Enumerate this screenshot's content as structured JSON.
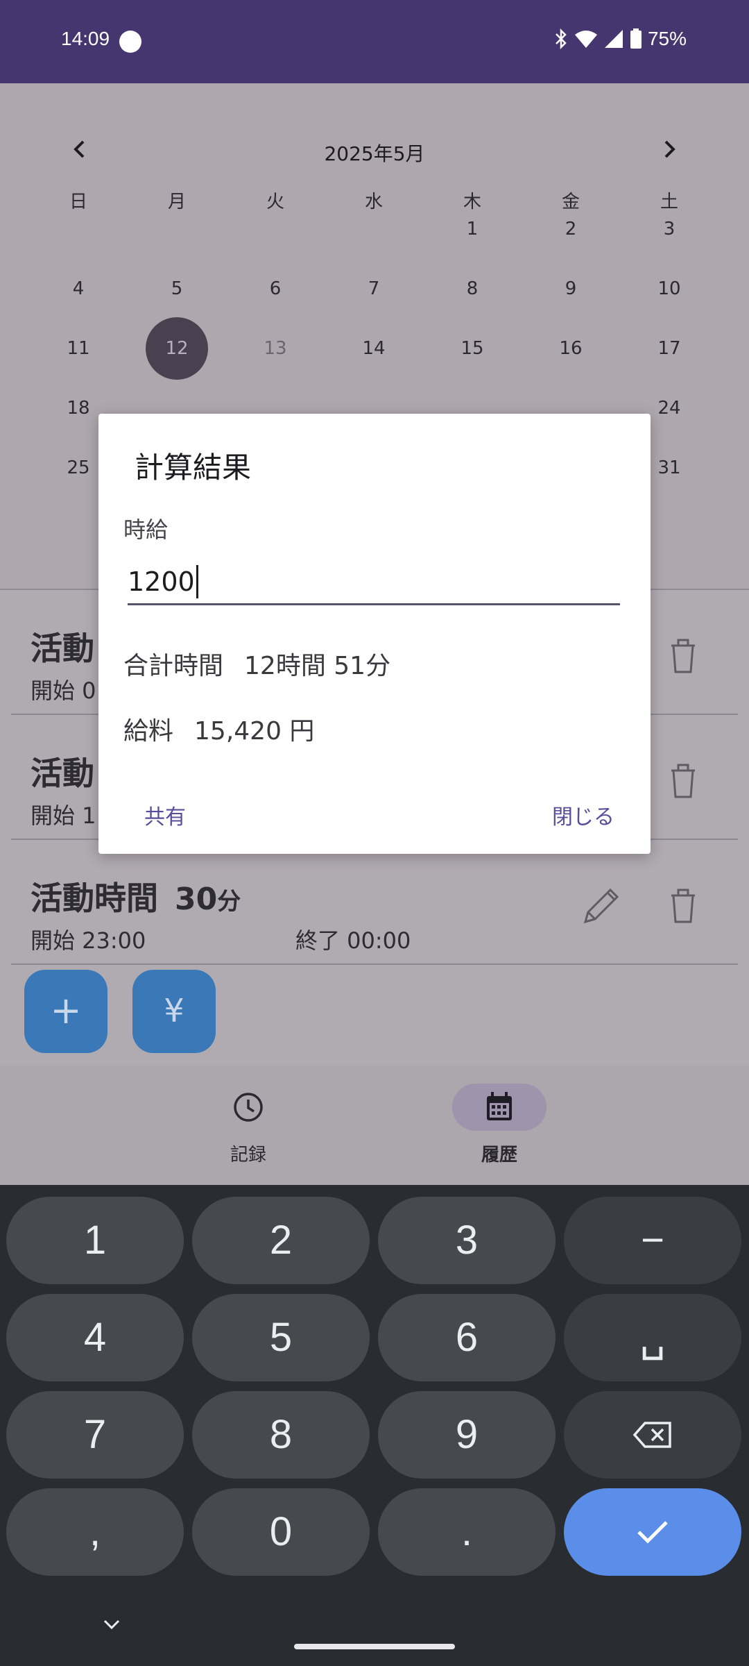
{
  "status_bar": {
    "time": "14:09",
    "battery": "75%"
  },
  "calendar": {
    "title": "2025年5月",
    "weekdays": [
      "日",
      "月",
      "火",
      "水",
      "木",
      "金",
      "土"
    ],
    "rows": [
      [
        "",
        "",
        "",
        "",
        "1",
        "2",
        "3"
      ],
      [
        "4",
        "5",
        "6",
        "7",
        "8",
        "9",
        "10"
      ],
      [
        "11",
        "12",
        "13",
        "14",
        "15",
        "16",
        "17"
      ],
      [
        "18",
        "",
        "",
        "",
        "",
        "",
        "24"
      ],
      [
        "25",
        "",
        "",
        "",
        "",
        "",
        "31"
      ]
    ],
    "selected_day": "12"
  },
  "entries": [
    {
      "title": "活動",
      "start": "開始 0"
    },
    {
      "title": "活動",
      "start": "開始 1"
    },
    {
      "title": "活動時間",
      "duration": "30",
      "duration_unit": "分",
      "start": "開始  23:00",
      "end": "終了  00:00"
    }
  ],
  "fabs": {
    "add": "+",
    "yen": "¥"
  },
  "nav": {
    "record_label": "記録",
    "history_label": "履歴"
  },
  "dialog": {
    "title": "計算結果",
    "wage_label": "時給",
    "wage_value": "1200",
    "total_label": "合計時間",
    "total_value": "12時間 51分",
    "salary_label": "給料",
    "salary_value": "15,420 円",
    "share_label": "共有",
    "close_label": "閉じる"
  },
  "keyboard": {
    "row1": [
      "1",
      "2",
      "3",
      "−"
    ],
    "row2": [
      "4",
      "5",
      "6",
      "␣"
    ],
    "row3": [
      "7",
      "8",
      "9"
    ],
    "row4": [
      ",",
      "0",
      "."
    ]
  },
  "colors": {
    "accent": "#45366f",
    "dialog_button": "#5a4c9c",
    "fab": "#3a78b8",
    "enter_key": "#5a8ee8"
  }
}
